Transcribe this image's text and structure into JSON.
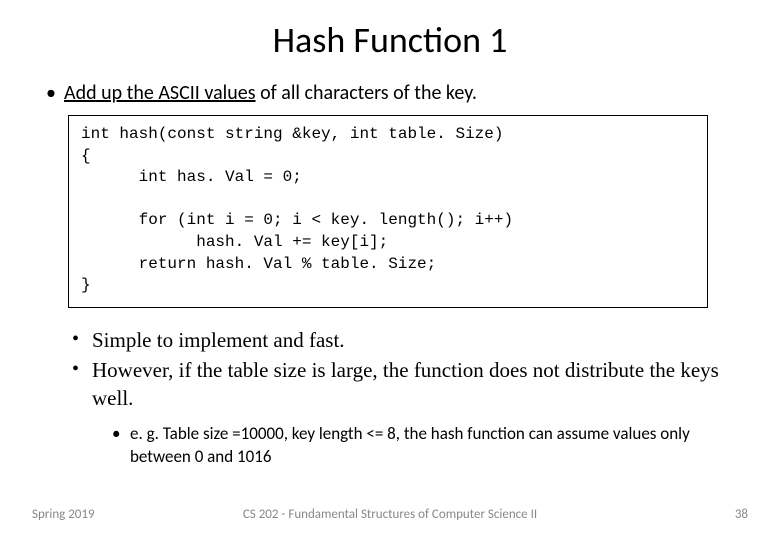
{
  "title": "Hash Function 1",
  "top_bullet_pre": "Add up the ASCII values",
  "top_bullet_post": " of all  characters of the key.",
  "code": "int hash(const string &key, int table. Size)\n{\n      int has. Val = 0;\n\n      for (int i = 0; i < key. length(); i++)\n            hash. Val += key[i];\n      return hash. Val % table. Size;\n}",
  "body_bullets": [
    "Simple to implement and fast.",
    "However, if the table size is large, the function does not distribute the keys well."
  ],
  "sub_bullet": "e. g. Table size =10000, key length <= 8, the hash function can assume values only between 0 and 1016",
  "footer": {
    "left": "Spring 2019",
    "center": "CS 202 - Fundamental Structures of Computer Science II",
    "right": "38"
  }
}
